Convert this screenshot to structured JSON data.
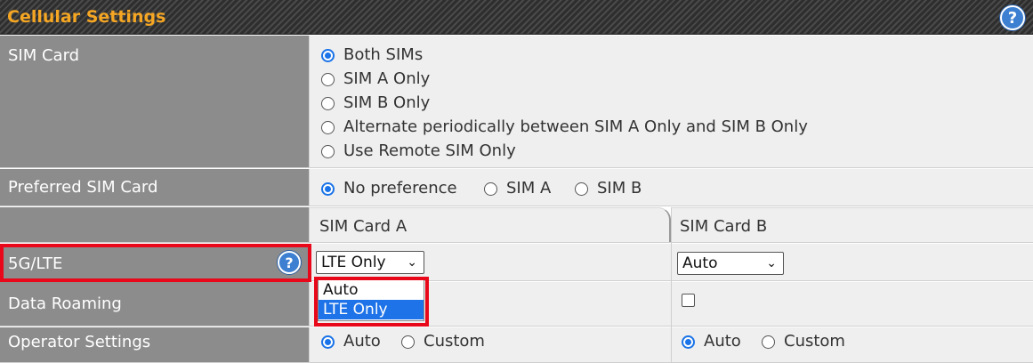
{
  "header": {
    "title": "Cellular Settings"
  },
  "sim_card": {
    "label": "SIM Card",
    "options": [
      "Both SIMs",
      "SIM A Only",
      "SIM B Only",
      "Alternate periodically between SIM A Only and SIM B Only",
      "Use Remote SIM Only"
    ],
    "selected": "Both SIMs"
  },
  "preferred_sim": {
    "label": "Preferred SIM Card",
    "options": [
      "No preference",
      "SIM A",
      "SIM B"
    ],
    "selected": "No preference"
  },
  "columns": {
    "sim_a": "SIM Card A",
    "sim_b": "SIM Card B"
  },
  "network_mode": {
    "label": "5G/LTE",
    "sim_a_value": "LTE Only",
    "sim_b_value": "Auto",
    "dropdown_options": [
      "Auto",
      "LTE Only"
    ],
    "dropdown_highlighted": "LTE Only"
  },
  "data_roaming": {
    "label": "Data Roaming",
    "sim_b_checked": false
  },
  "operator_settings": {
    "label": "Operator Settings",
    "sim_a": {
      "options": [
        "Auto",
        "Custom"
      ],
      "selected": "Auto"
    },
    "sim_b": {
      "options": [
        "Auto",
        "Custom"
      ],
      "selected": "Auto"
    }
  },
  "colors": {
    "title": "#f5a623",
    "label_bg": "#8c8c8c",
    "value_bg": "#efefef",
    "accent": "#1a73e8",
    "highlight_box": "#e8081a"
  },
  "icons": {
    "help": "question-mark-circle-icon",
    "chevron": "chevron-down-icon"
  }
}
